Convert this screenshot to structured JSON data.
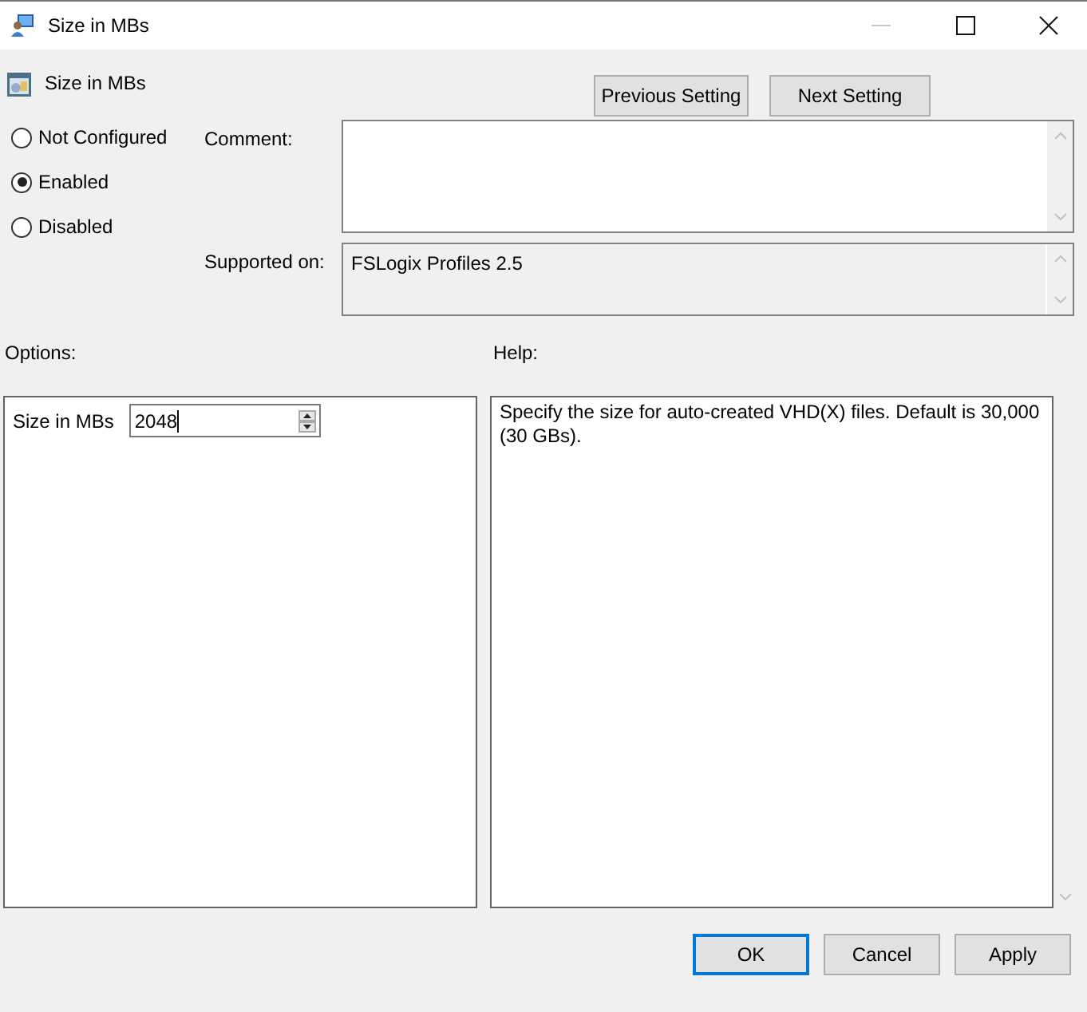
{
  "window": {
    "title": "Size in MBs"
  },
  "header": {
    "title": "Size in MBs"
  },
  "nav_buttons": [
    {
      "label": "Previous Setting"
    },
    {
      "label": "Next Setting"
    }
  ],
  "state_options": [
    {
      "label": "Not Configured",
      "selected": false
    },
    {
      "label": "Enabled",
      "selected": true
    },
    {
      "label": "Disabled",
      "selected": false
    }
  ],
  "comment": {
    "label": "Comment:"
  },
  "supported_on": {
    "label": "Supported on:",
    "value": "FSLogix Profiles 2.5"
  },
  "options": {
    "label": "Options:",
    "field": {
      "label": "Size in MBs",
      "value": "2048"
    }
  },
  "help": {
    "label": "Help:",
    "text": "Specify the size for auto-created VHD(X) files. Default is 30,000 (30 GBs)."
  },
  "buttons": [
    {
      "label": "OK",
      "default": true
    },
    {
      "label": "Cancel",
      "default": false
    },
    {
      "label": "Apply",
      "default": false
    }
  ]
}
